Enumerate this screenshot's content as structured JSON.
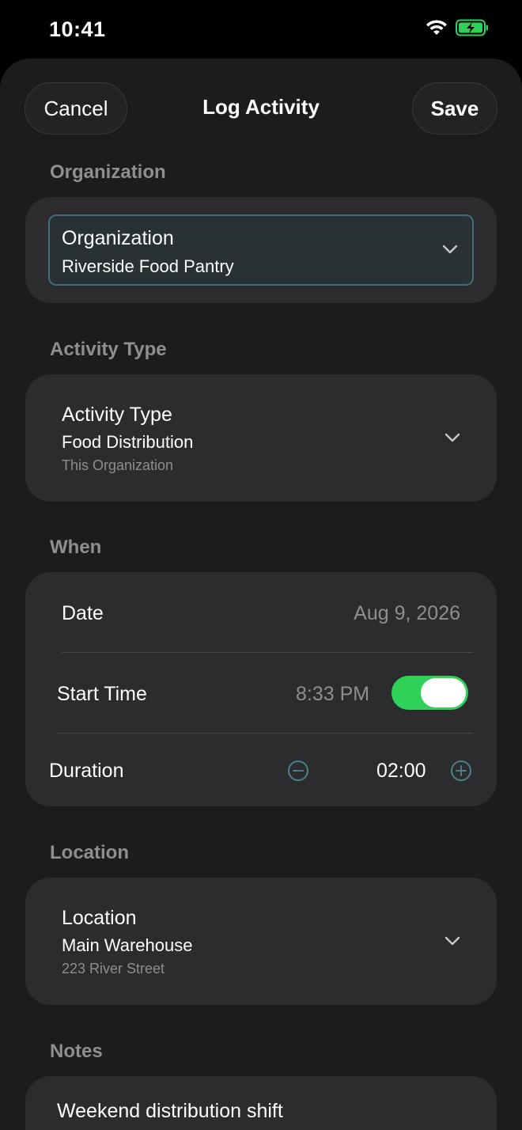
{
  "status_bar": {
    "time": "10:41"
  },
  "nav": {
    "cancel_label": "Cancel",
    "title": "Log Activity",
    "save_label": "Save"
  },
  "sections": {
    "organization": "Organization",
    "activity_type": "Activity Type",
    "when": "When",
    "location": "Location",
    "notes": "Notes"
  },
  "organization": {
    "title": "Organization",
    "value": "Riverside Food Pantry"
  },
  "activity_type": {
    "title": "Activity Type",
    "value": "Food Distribution",
    "sub": "This Organization"
  },
  "when": {
    "date_label": "Date",
    "date_value": "Aug 9, 2026",
    "start_label": "Start Time",
    "start_value": "8:33 PM",
    "start_enabled": true,
    "duration_label": "Duration",
    "duration_value": "02:00"
  },
  "location": {
    "title": "Location",
    "value": "Main Warehouse",
    "sub": "223 River Street"
  },
  "notes": {
    "value": "Weekend distribution shift"
  },
  "colors": {
    "accent_toggle": "#30d158",
    "focus_border": "#3f6e7c",
    "stepper": "#4a7d8c"
  }
}
